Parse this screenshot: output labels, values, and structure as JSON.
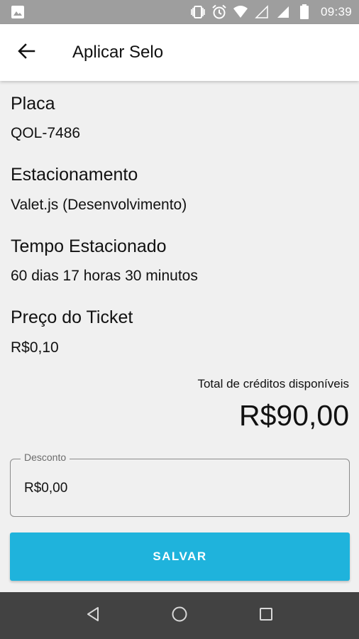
{
  "status_bar": {
    "time": "09:39",
    "icons": [
      "image-icon",
      "vibrate-icon",
      "alarm-icon",
      "wifi-icon",
      "signal-icon",
      "signal-icon",
      "battery-icon"
    ]
  },
  "app_bar": {
    "title": "Aplicar Selo",
    "back_icon": "arrow-back-icon"
  },
  "details": {
    "plate_label": "Placa",
    "plate_value": "QOL-7486",
    "parking_label": "Estacionamento",
    "parking_value": "Valet.js (Desenvolvimento)",
    "time_label": "Tempo Estacionado",
    "time_value": "60 dias 17 horas 30 minutos",
    "price_label": "Preço do Ticket",
    "price_value": "R$0,10"
  },
  "credits": {
    "label": "Total de créditos disponíveis",
    "value": "R$90,00"
  },
  "discount": {
    "label": "Desconto",
    "value": "R$0,00"
  },
  "save_label": "SALVAR",
  "nav_bar": {
    "icons": [
      "back-triangle-icon",
      "home-circle-icon",
      "recents-square-icon"
    ]
  },
  "colors": {
    "status_bar": "#9e9e9e",
    "background": "#f0f0f0",
    "button": "#1fb3dc",
    "nav_bar": "#424242"
  }
}
